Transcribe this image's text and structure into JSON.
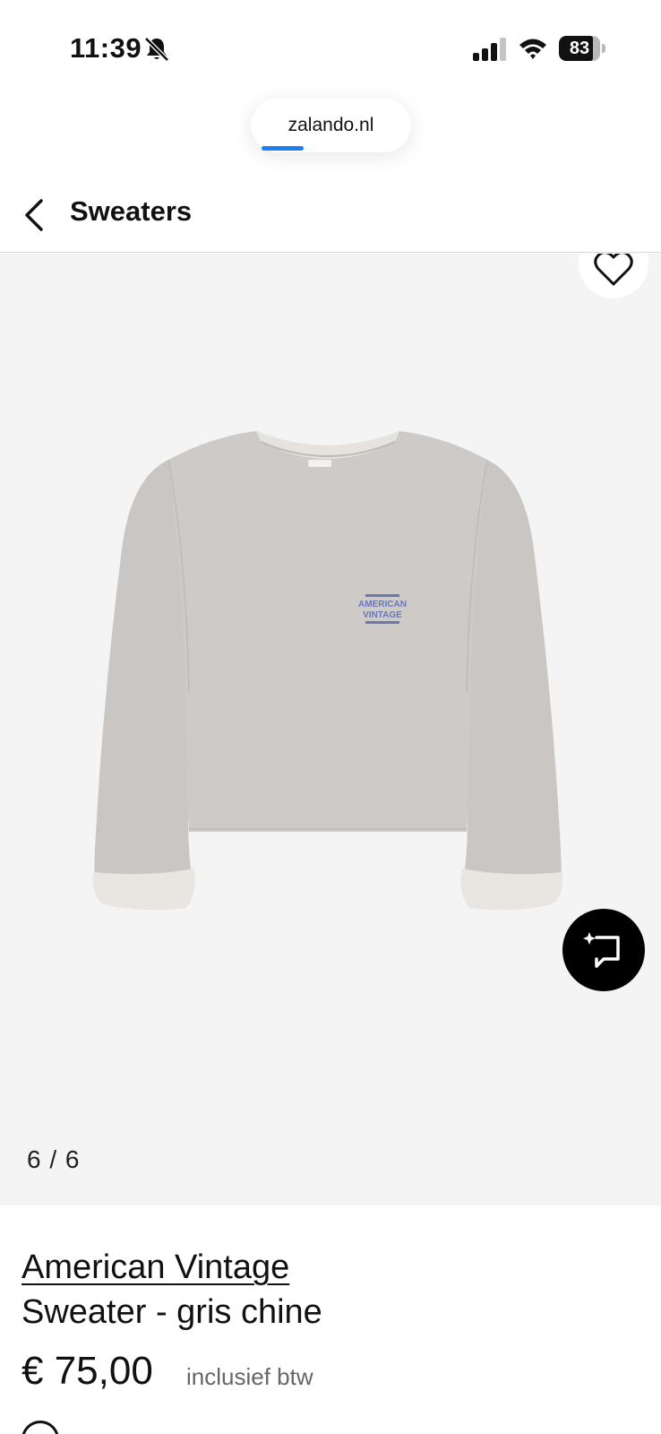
{
  "status_bar": {
    "time": "11:39",
    "battery_level": "83",
    "battery_fraction": 0.83
  },
  "browser": {
    "url": "zalando.nl",
    "load_progress": 0.3
  },
  "header": {
    "title": "Sweaters"
  },
  "gallery": {
    "counter": "6 / 6",
    "logo_text": "AMERICAN VINTAGE"
  },
  "product": {
    "brand": "American Vintage",
    "name": "Sweater - gris chine",
    "price": "€ 75,00",
    "vat_note": "inclusief btw"
  },
  "colors": {
    "accent": "#1f7ff2",
    "gallery_bg": "#f4f4f5",
    "sweater": "#cbc8c5"
  },
  "icons": [
    "bell-slash-icon",
    "signal-icon",
    "wifi-icon",
    "battery-icon",
    "back-chevron-icon",
    "heart-icon",
    "visual-search-icon"
  ]
}
